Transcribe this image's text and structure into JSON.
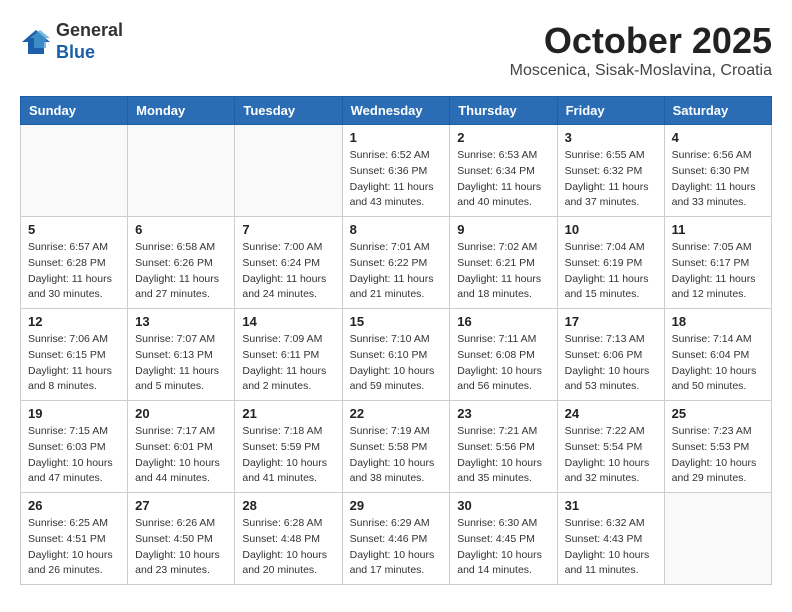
{
  "header": {
    "logo_line1": "General",
    "logo_line2": "Blue",
    "month": "October 2025",
    "location": "Moscenica, Sisak-Moslavina, Croatia"
  },
  "weekdays": [
    "Sunday",
    "Monday",
    "Tuesday",
    "Wednesday",
    "Thursday",
    "Friday",
    "Saturday"
  ],
  "weeks": [
    [
      {
        "day": "",
        "info": ""
      },
      {
        "day": "",
        "info": ""
      },
      {
        "day": "",
        "info": ""
      },
      {
        "day": "1",
        "info": "Sunrise: 6:52 AM\nSunset: 6:36 PM\nDaylight: 11 hours\nand 43 minutes."
      },
      {
        "day": "2",
        "info": "Sunrise: 6:53 AM\nSunset: 6:34 PM\nDaylight: 11 hours\nand 40 minutes."
      },
      {
        "day": "3",
        "info": "Sunrise: 6:55 AM\nSunset: 6:32 PM\nDaylight: 11 hours\nand 37 minutes."
      },
      {
        "day": "4",
        "info": "Sunrise: 6:56 AM\nSunset: 6:30 PM\nDaylight: 11 hours\nand 33 minutes."
      }
    ],
    [
      {
        "day": "5",
        "info": "Sunrise: 6:57 AM\nSunset: 6:28 PM\nDaylight: 11 hours\nand 30 minutes."
      },
      {
        "day": "6",
        "info": "Sunrise: 6:58 AM\nSunset: 6:26 PM\nDaylight: 11 hours\nand 27 minutes."
      },
      {
        "day": "7",
        "info": "Sunrise: 7:00 AM\nSunset: 6:24 PM\nDaylight: 11 hours\nand 24 minutes."
      },
      {
        "day": "8",
        "info": "Sunrise: 7:01 AM\nSunset: 6:22 PM\nDaylight: 11 hours\nand 21 minutes."
      },
      {
        "day": "9",
        "info": "Sunrise: 7:02 AM\nSunset: 6:21 PM\nDaylight: 11 hours\nand 18 minutes."
      },
      {
        "day": "10",
        "info": "Sunrise: 7:04 AM\nSunset: 6:19 PM\nDaylight: 11 hours\nand 15 minutes."
      },
      {
        "day": "11",
        "info": "Sunrise: 7:05 AM\nSunset: 6:17 PM\nDaylight: 11 hours\nand 12 minutes."
      }
    ],
    [
      {
        "day": "12",
        "info": "Sunrise: 7:06 AM\nSunset: 6:15 PM\nDaylight: 11 hours\nand 8 minutes."
      },
      {
        "day": "13",
        "info": "Sunrise: 7:07 AM\nSunset: 6:13 PM\nDaylight: 11 hours\nand 5 minutes."
      },
      {
        "day": "14",
        "info": "Sunrise: 7:09 AM\nSunset: 6:11 PM\nDaylight: 11 hours\nand 2 minutes."
      },
      {
        "day": "15",
        "info": "Sunrise: 7:10 AM\nSunset: 6:10 PM\nDaylight: 10 hours\nand 59 minutes."
      },
      {
        "day": "16",
        "info": "Sunrise: 7:11 AM\nSunset: 6:08 PM\nDaylight: 10 hours\nand 56 minutes."
      },
      {
        "day": "17",
        "info": "Sunrise: 7:13 AM\nSunset: 6:06 PM\nDaylight: 10 hours\nand 53 minutes."
      },
      {
        "day": "18",
        "info": "Sunrise: 7:14 AM\nSunset: 6:04 PM\nDaylight: 10 hours\nand 50 minutes."
      }
    ],
    [
      {
        "day": "19",
        "info": "Sunrise: 7:15 AM\nSunset: 6:03 PM\nDaylight: 10 hours\nand 47 minutes."
      },
      {
        "day": "20",
        "info": "Sunrise: 7:17 AM\nSunset: 6:01 PM\nDaylight: 10 hours\nand 44 minutes."
      },
      {
        "day": "21",
        "info": "Sunrise: 7:18 AM\nSunset: 5:59 PM\nDaylight: 10 hours\nand 41 minutes."
      },
      {
        "day": "22",
        "info": "Sunrise: 7:19 AM\nSunset: 5:58 PM\nDaylight: 10 hours\nand 38 minutes."
      },
      {
        "day": "23",
        "info": "Sunrise: 7:21 AM\nSunset: 5:56 PM\nDaylight: 10 hours\nand 35 minutes."
      },
      {
        "day": "24",
        "info": "Sunrise: 7:22 AM\nSunset: 5:54 PM\nDaylight: 10 hours\nand 32 minutes."
      },
      {
        "day": "25",
        "info": "Sunrise: 7:23 AM\nSunset: 5:53 PM\nDaylight: 10 hours\nand 29 minutes."
      }
    ],
    [
      {
        "day": "26",
        "info": "Sunrise: 6:25 AM\nSunset: 4:51 PM\nDaylight: 10 hours\nand 26 minutes."
      },
      {
        "day": "27",
        "info": "Sunrise: 6:26 AM\nSunset: 4:50 PM\nDaylight: 10 hours\nand 23 minutes."
      },
      {
        "day": "28",
        "info": "Sunrise: 6:28 AM\nSunset: 4:48 PM\nDaylight: 10 hours\nand 20 minutes."
      },
      {
        "day": "29",
        "info": "Sunrise: 6:29 AM\nSunset: 4:46 PM\nDaylight: 10 hours\nand 17 minutes."
      },
      {
        "day": "30",
        "info": "Sunrise: 6:30 AM\nSunset: 4:45 PM\nDaylight: 10 hours\nand 14 minutes."
      },
      {
        "day": "31",
        "info": "Sunrise: 6:32 AM\nSunset: 4:43 PM\nDaylight: 10 hours\nand 11 minutes."
      },
      {
        "day": "",
        "info": ""
      }
    ]
  ]
}
